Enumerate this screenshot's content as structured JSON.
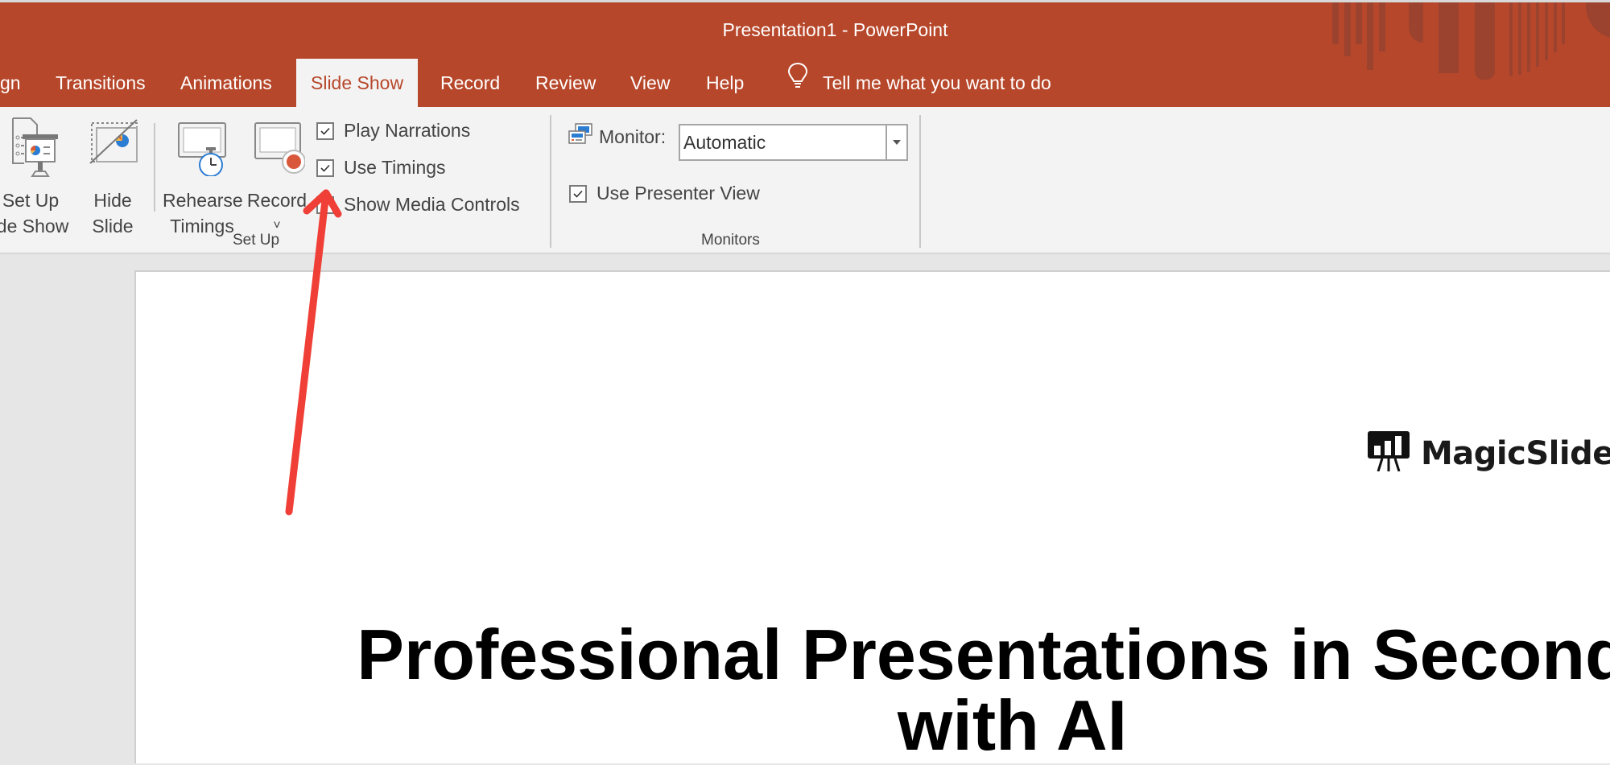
{
  "window": {
    "title": "Presentation1  -  PowerPoint",
    "accent_color": "#b7472a"
  },
  "tabs": [
    {
      "label": "gn",
      "active": false
    },
    {
      "label": "Transitions",
      "active": false
    },
    {
      "label": "Animations",
      "active": false
    },
    {
      "label": "Slide Show",
      "active": true
    },
    {
      "label": "Record",
      "active": false
    },
    {
      "label": "Review",
      "active": false
    },
    {
      "label": "View",
      "active": false
    },
    {
      "label": "Help",
      "active": false
    }
  ],
  "tell_me": {
    "icon": "lightbulb-icon",
    "placeholder": "Tell me what you want to do"
  },
  "ribbon": {
    "setup_group": {
      "label": "Set Up",
      "buttons": [
        {
          "line1": "Set Up",
          "line2": "ide Show",
          "icon": "setup-slideshow-icon"
        },
        {
          "line1": "Hide",
          "line2": "Slide",
          "icon": "hide-slide-icon"
        },
        {
          "line1": "Rehearse",
          "line2": "Timings",
          "icon": "rehearse-timings-icon"
        },
        {
          "line1": "Record",
          "line2": "˅",
          "icon": "record-icon"
        }
      ],
      "checkboxes": [
        {
          "label": "Play Narrations",
          "checked": true
        },
        {
          "label": "Use Timings",
          "checked": true
        },
        {
          "label": "Show Media Controls",
          "checked": false
        }
      ]
    },
    "monitors_group": {
      "label": "Monitors",
      "monitor_label": "Monitor:",
      "monitor_value": "Automatic",
      "presenter_view": {
        "label": "Use Presenter View",
        "checked": true
      }
    }
  },
  "slide": {
    "logo_text": "MagicSlides",
    "headline_line1": "Professional Presentations in Seconds",
    "headline_line2": "with AI"
  },
  "annotation": {
    "type": "arrow",
    "color": "#ef3f36",
    "points_to": "Use Timings"
  }
}
